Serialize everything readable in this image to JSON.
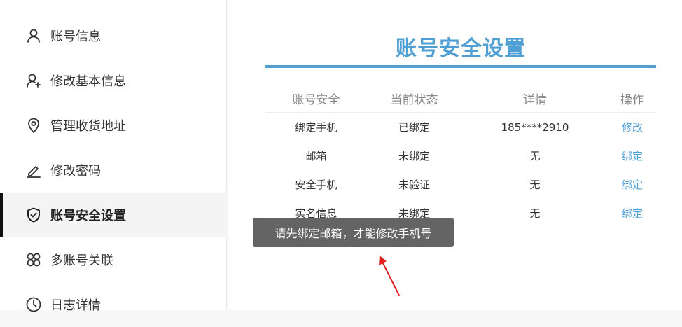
{
  "sidebar": {
    "items": [
      {
        "label": "账号信息",
        "icon": "user-icon",
        "active": false
      },
      {
        "label": "修改基本信息",
        "icon": "user-plus-icon",
        "active": false
      },
      {
        "label": "管理收货地址",
        "icon": "location-pin-icon",
        "active": false
      },
      {
        "label": "修改密码",
        "icon": "pencil-icon",
        "active": false
      },
      {
        "label": "账号安全设置",
        "icon": "shield-check-icon",
        "active": true
      },
      {
        "label": "多账号关联",
        "icon": "linked-accounts-icon",
        "active": false
      },
      {
        "label": "日志详情",
        "icon": "clock-icon",
        "active": false
      }
    ]
  },
  "main": {
    "title": "账号安全设置",
    "table": {
      "headers": [
        "账号安全",
        "当前状态",
        "详情",
        "操作"
      ],
      "rows": [
        {
          "item": "绑定手机",
          "status": "已绑定",
          "detail": "185****2910",
          "action": "修改"
        },
        {
          "item": "邮箱",
          "status": "未绑定",
          "detail": "无",
          "action": "绑定"
        },
        {
          "item": "安全手机",
          "status": "未验证",
          "detail": "无",
          "action": "绑定"
        },
        {
          "item": "实名信息",
          "status": "未绑定",
          "detail": "无",
          "action": "绑定"
        }
      ]
    }
  },
  "toast": {
    "message": "请先绑定邮箱，才能修改手机号"
  },
  "colors": {
    "accent": "#4f9fd4",
    "toast_bg": "#5a5a5a",
    "arrow": "#e02020",
    "active_marker": "#111111"
  }
}
